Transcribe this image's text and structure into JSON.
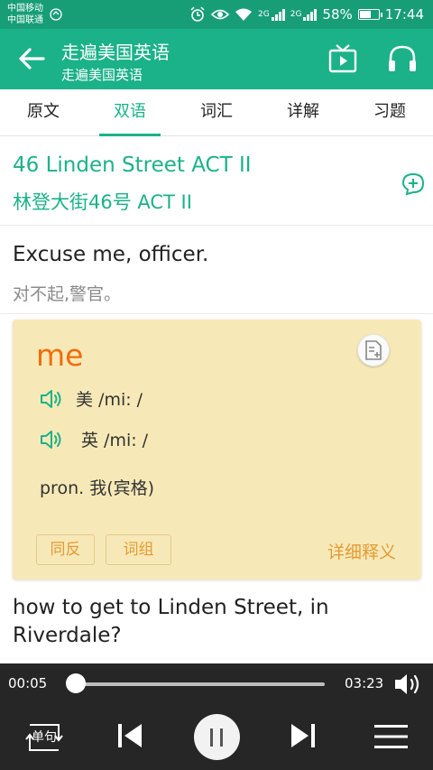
{
  "status": {
    "carrier1": "中国移动",
    "carrier2": "中国联通",
    "net1": "2G",
    "net2": "2G",
    "battery": "58%",
    "battery_level": 0.58,
    "time": "17:44"
  },
  "appbar": {
    "title": "走遍美国英语",
    "subtitle": "走遍美国英语",
    "icons": [
      "back-arrow-icon",
      "tv-play-icon",
      "headphones-icon"
    ]
  },
  "tabs": [
    "原文",
    "双语",
    "词汇",
    "详解",
    "习题"
  ],
  "active_tab": 1,
  "lesson": {
    "title_en": "46 Linden Street ACT II",
    "title_cn": "林登大街46号 ACT II"
  },
  "sentences": [
    {
      "en": "Excuse me, officer.",
      "cn": "对不起,警官。"
    },
    {
      "en": "how to get to Linden Street, in Riverdale?"
    }
  ],
  "word_card": {
    "word": "me",
    "us_label": "美 /mi: /",
    "uk_label": "英 /mi: /",
    "definition": "pron. 我(宾格)",
    "chip1": "同反",
    "chip2": "词组",
    "detail_link": "详细释义"
  },
  "player": {
    "current": "00:05",
    "total": "03:23",
    "progress": 0.025,
    "mode_label": "单句"
  },
  "colors": {
    "primary": "#1bb289",
    "statusbar": "#179e77",
    "card_bg": "#f7e9b7",
    "word_orange": "#f26c0d",
    "chip_text": "#e49a35",
    "player_bg": "#262626"
  }
}
